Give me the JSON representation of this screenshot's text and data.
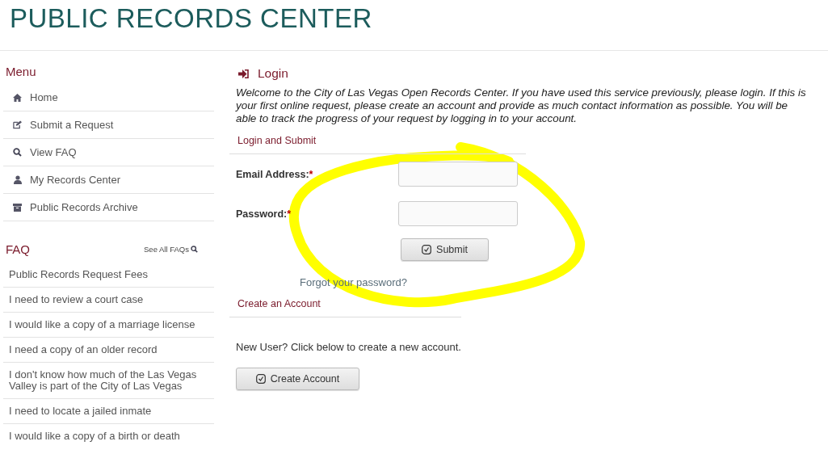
{
  "header": {
    "title": "PUBLIC RECORDS CENTER"
  },
  "menu": {
    "title": "Menu",
    "items": [
      {
        "label": "Home"
      },
      {
        "label": "Submit a Request"
      },
      {
        "label": "View FAQ"
      },
      {
        "label": "My Records Center"
      },
      {
        "label": "Public Records Archive"
      }
    ]
  },
  "faq": {
    "title": "FAQ",
    "see_all": "See All FAQs",
    "items": [
      "Public Records Request Fees",
      "I need to review a court case",
      "I would like a copy of a marriage license",
      "I need a copy of an older record",
      "I don't know how much of the Las Vegas Valley is part of the City of Las Vegas",
      "I need to locate a jailed inmate",
      "I would like a copy of a birth or death"
    ]
  },
  "login": {
    "title": "Login",
    "intro": "Welcome to the City of Las Vegas Open Records Center. If you have used this service previously, please login. If this is your first online request, please create an account and provide as much contact information as possible. You will be able to track the progress of your request by logging in to your account.",
    "section": "Login and Submit",
    "fields": [
      {
        "label": "Email Address:",
        "required_mark": "*"
      },
      {
        "label": "Password:",
        "required_mark": "*"
      }
    ],
    "submit": "Submit",
    "forgot": "Forgot your password?"
  },
  "create": {
    "section": "Create an Account",
    "text": "New User? Click below to create a new account.",
    "button": "Create Account"
  }
}
